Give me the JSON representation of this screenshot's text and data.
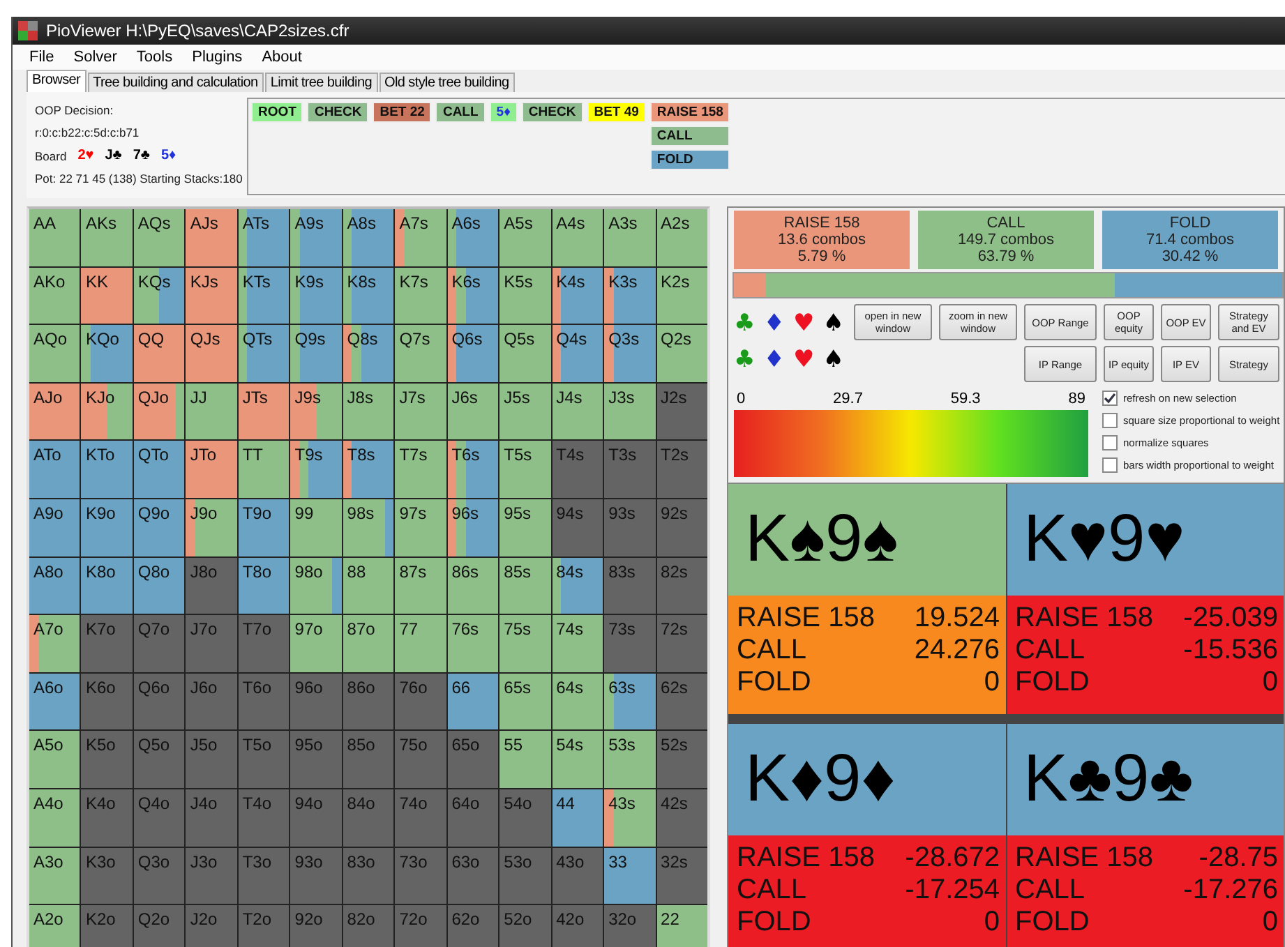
{
  "window": {
    "title": "PioViewer H:\\PyEQ\\saves\\CAP2sizes.cfr"
  },
  "menu": [
    "File",
    "Solver",
    "Tools",
    "Plugins",
    "About"
  ],
  "tabs": [
    {
      "label": "Browser",
      "selected": true
    },
    {
      "label": "Tree building and calculation",
      "selected": false
    },
    {
      "label": "Limit tree building",
      "selected": false
    },
    {
      "label": "Old style tree building",
      "selected": false
    }
  ],
  "info": {
    "decision": "OOP Decision:",
    "line": "r:0:c:b22:c:5d:c:b71",
    "board_label": "Board",
    "board": [
      {
        "text": "2♥",
        "color": "#ff0000"
      },
      {
        "text": "J♣",
        "color": "#000000"
      },
      {
        "text": "7♣",
        "color": "#000000"
      },
      {
        "text": "5♦",
        "color": "#2233dd"
      }
    ],
    "pot": "Pot: 22 71 45 (138) Starting Stacks:180"
  },
  "tree": {
    "path": [
      {
        "label": "ROOT",
        "kind": "action",
        "color": "#90ee90"
      },
      {
        "label": "CHECK",
        "kind": "action",
        "color": "#8fbc8f"
      },
      {
        "label": "BET 22",
        "kind": "action",
        "color": "#c8745c"
      },
      {
        "label": "CALL",
        "kind": "action",
        "color": "#8fbc8f"
      },
      {
        "label": "5♦",
        "kind": "card",
        "color": "#90ee90"
      },
      {
        "label": "CHECK",
        "kind": "action",
        "color": "#8fbc8f"
      },
      {
        "label": "BET 49",
        "kind": "action",
        "color": "#ffff00"
      },
      {
        "label": "RAISE 158",
        "kind": "action",
        "color": "#e9967a"
      }
    ],
    "options": [
      {
        "label": "CALL",
        "kind": "action",
        "color": "#8fbc8f"
      },
      {
        "label": "FOLD",
        "kind": "action",
        "color": "#6aa3c3"
      }
    ]
  },
  "grid": {
    "rows": [
      {
        "cells": [
          {
            "hand": "AA",
            "in_range": true,
            "segments": [
              {
                "kind": "call",
                "dominant": true
              }
            ]
          },
          {
            "hand": "AKs",
            "in_range": true,
            "segments": [
              {
                "kind": "call",
                "dominant": true
              }
            ]
          },
          {
            "hand": "AQs",
            "in_range": true,
            "segments": [
              {
                "kind": "call",
                "dominant": true
              }
            ]
          },
          {
            "hand": "AJs",
            "in_range": true,
            "segments": [
              {
                "kind": "raise",
                "dominant": true
              }
            ]
          },
          {
            "hand": "ATs",
            "in_range": true,
            "segments": [
              {
                "kind": "call",
                "dominant": false
              },
              {
                "kind": "fold",
                "dominant": true
              }
            ]
          },
          {
            "hand": "A9s",
            "in_range": true,
            "segments": [
              {
                "kind": "call",
                "dominant": false
              },
              {
                "kind": "fold",
                "dominant": true
              }
            ]
          },
          {
            "hand": "A8s",
            "in_range": true,
            "segments": [
              {
                "kind": "call",
                "dominant": false
              },
              {
                "kind": "fold",
                "dominant": true
              }
            ]
          },
          {
            "hand": "A7s",
            "in_range": true,
            "segments": [
              {
                "kind": "raise",
                "dominant": false
              },
              {
                "kind": "call",
                "dominant": true
              }
            ]
          },
          {
            "hand": "A6s",
            "in_range": true,
            "segments": [
              {
                "kind": "call",
                "dominant": false
              },
              {
                "kind": "fold",
                "dominant": true
              }
            ]
          },
          {
            "hand": "A5s",
            "in_range": true,
            "segments": [
              {
                "kind": "call",
                "dominant": true
              }
            ]
          },
          {
            "hand": "A4s",
            "in_range": true,
            "segments": [
              {
                "kind": "call",
                "dominant": true
              }
            ]
          },
          {
            "hand": "A3s",
            "in_range": true,
            "segments": [
              {
                "kind": "call",
                "dominant": true
              }
            ]
          },
          {
            "hand": "A2s",
            "in_range": true,
            "segments": [
              {
                "kind": "call",
                "dominant": true
              }
            ]
          }
        ]
      },
      {
        "cells": [
          {
            "hand": "AKo",
            "in_range": true,
            "segments": [
              {
                "kind": "call",
                "dominant": true
              }
            ]
          },
          {
            "hand": "KK",
            "in_range": true,
            "segments": [
              {
                "kind": "raise",
                "dominant": true
              }
            ]
          },
          {
            "hand": "KQs",
            "in_range": true,
            "segments": [
              {
                "kind": "call",
                "dominant": true
              },
              {
                "kind": "fold",
                "dominant": true
              }
            ]
          },
          {
            "hand": "KJs",
            "in_range": true,
            "segments": [
              {
                "kind": "raise",
                "dominant": true
              }
            ]
          },
          {
            "hand": "KTs",
            "in_range": true,
            "segments": [
              {
                "kind": "call",
                "dominant": false
              },
              {
                "kind": "fold",
                "dominant": true
              }
            ]
          },
          {
            "hand": "K9s",
            "in_range": true,
            "segments": [
              {
                "kind": "call",
                "dominant": false
              },
              {
                "kind": "fold",
                "dominant": true
              }
            ]
          },
          {
            "hand": "K8s",
            "in_range": true,
            "segments": [
              {
                "kind": "call",
                "dominant": false
              },
              {
                "kind": "fold",
                "dominant": true
              }
            ]
          },
          {
            "hand": "K7s",
            "in_range": true,
            "segments": [
              {
                "kind": "call",
                "dominant": true
              }
            ]
          },
          {
            "hand": "K6s",
            "in_range": true,
            "segments": [
              {
                "kind": "raise",
                "dominant": false
              },
              {
                "kind": "call",
                "dominant": false
              },
              {
                "kind": "fold",
                "dominant": true
              }
            ]
          },
          {
            "hand": "K5s",
            "in_range": true,
            "segments": [
              {
                "kind": "call",
                "dominant": true
              }
            ]
          },
          {
            "hand": "K4s",
            "in_range": true,
            "segments": [
              {
                "kind": "raise",
                "dominant": false
              },
              {
                "kind": "fold",
                "dominant": true
              }
            ]
          },
          {
            "hand": "K3s",
            "in_range": true,
            "segments": [
              {
                "kind": "raise",
                "dominant": false
              },
              {
                "kind": "fold",
                "dominant": true
              }
            ]
          },
          {
            "hand": "K2s",
            "in_range": true,
            "segments": [
              {
                "kind": "call",
                "dominant": true
              }
            ]
          }
        ]
      },
      {
        "cells": [
          {
            "hand": "AQo",
            "in_range": true,
            "segments": [
              {
                "kind": "call",
                "dominant": true
              }
            ]
          },
          {
            "hand": "KQo",
            "in_range": true,
            "segments": [
              {
                "kind": "call",
                "dominant": false
              },
              {
                "kind": "fold",
                "dominant": true
              }
            ]
          },
          {
            "hand": "QQ",
            "in_range": true,
            "segments": [
              {
                "kind": "raise",
                "dominant": true
              }
            ]
          },
          {
            "hand": "QJs",
            "in_range": true,
            "segments": [
              {
                "kind": "raise",
                "dominant": true
              }
            ]
          },
          {
            "hand": "QTs",
            "in_range": true,
            "segments": [
              {
                "kind": "call",
                "dominant": false
              },
              {
                "kind": "fold",
                "dominant": true
              }
            ]
          },
          {
            "hand": "Q9s",
            "in_range": true,
            "segments": [
              {
                "kind": "call",
                "dominant": false
              },
              {
                "kind": "fold",
                "dominant": true
              }
            ]
          },
          {
            "hand": "Q8s",
            "in_range": true,
            "segments": [
              {
                "kind": "raise",
                "dominant": false
              },
              {
                "kind": "call",
                "dominant": false
              },
              {
                "kind": "fold",
                "dominant": true
              }
            ]
          },
          {
            "hand": "Q7s",
            "in_range": true,
            "segments": [
              {
                "kind": "call",
                "dominant": true
              }
            ]
          },
          {
            "hand": "Q6s",
            "in_range": true,
            "segments": [
              {
                "kind": "raise",
                "dominant": false
              },
              {
                "kind": "fold",
                "dominant": true
              }
            ]
          },
          {
            "hand": "Q5s",
            "in_range": true,
            "segments": [
              {
                "kind": "call",
                "dominant": true
              }
            ]
          },
          {
            "hand": "Q4s",
            "in_range": true,
            "segments": [
              {
                "kind": "raise",
                "dominant": false
              },
              {
                "kind": "fold",
                "dominant": true
              }
            ]
          },
          {
            "hand": "Q3s",
            "in_range": true,
            "segments": [
              {
                "kind": "raise",
                "dominant": false
              },
              {
                "kind": "fold",
                "dominant": true
              }
            ]
          },
          {
            "hand": "Q2s",
            "in_range": true,
            "segments": [
              {
                "kind": "call",
                "dominant": true
              }
            ]
          }
        ]
      },
      {
        "cells": [
          {
            "hand": "AJo",
            "in_range": true,
            "segments": [
              {
                "kind": "raise",
                "dominant": true
              }
            ]
          },
          {
            "hand": "KJo",
            "in_range": true,
            "segments": [
              {
                "kind": "raise",
                "dominant": true
              },
              {
                "kind": "call",
                "dominant": true
              }
            ]
          },
          {
            "hand": "QJo",
            "in_range": true,
            "segments": [
              {
                "kind": "raise",
                "dominant": true
              },
              {
                "kind": "call",
                "dominant": false
              }
            ]
          },
          {
            "hand": "JJ",
            "in_range": true,
            "segments": [
              {
                "kind": "call",
                "dominant": true
              }
            ]
          },
          {
            "hand": "JTs",
            "in_range": true,
            "segments": [
              {
                "kind": "raise",
                "dominant": true
              }
            ]
          },
          {
            "hand": "J9s",
            "in_range": true,
            "segments": [
              {
                "kind": "raise",
                "dominant": true
              },
              {
                "kind": "call",
                "dominant": true
              }
            ]
          },
          {
            "hand": "J8s",
            "in_range": true,
            "segments": [
              {
                "kind": "call",
                "dominant": true
              }
            ]
          },
          {
            "hand": "J7s",
            "in_range": true,
            "segments": [
              {
                "kind": "call",
                "dominant": true
              }
            ]
          },
          {
            "hand": "J6s",
            "in_range": true,
            "segments": [
              {
                "kind": "call",
                "dominant": true
              }
            ]
          },
          {
            "hand": "J5s",
            "in_range": true,
            "segments": [
              {
                "kind": "call",
                "dominant": true
              }
            ]
          },
          {
            "hand": "J4s",
            "in_range": true,
            "segments": [
              {
                "kind": "call",
                "dominant": true
              }
            ]
          },
          {
            "hand": "J3s",
            "in_range": true,
            "segments": [
              {
                "kind": "call",
                "dominant": true
              }
            ]
          },
          {
            "hand": "J2s",
            "in_range": false
          }
        ]
      },
      {
        "cells": [
          {
            "hand": "ATo",
            "in_range": true,
            "segments": [
              {
                "kind": "fold",
                "dominant": true
              }
            ]
          },
          {
            "hand": "KTo",
            "in_range": true,
            "segments": [
              {
                "kind": "fold",
                "dominant": true
              }
            ]
          },
          {
            "hand": "QTo",
            "in_range": true,
            "segments": [
              {
                "kind": "fold",
                "dominant": true
              }
            ]
          },
          {
            "hand": "JTo",
            "in_range": true,
            "segments": [
              {
                "kind": "raise",
                "dominant": true
              }
            ]
          },
          {
            "hand": "TT",
            "in_range": true,
            "segments": [
              {
                "kind": "call",
                "dominant": true
              }
            ]
          },
          {
            "hand": "T9s",
            "in_range": true,
            "segments": [
              {
                "kind": "raise",
                "dominant": false
              },
              {
                "kind": "call",
                "dominant": false
              },
              {
                "kind": "fold",
                "dominant": true
              }
            ]
          },
          {
            "hand": "T8s",
            "in_range": true,
            "segments": [
              {
                "kind": "raise",
                "dominant": false
              },
              {
                "kind": "fold",
                "dominant": true
              }
            ]
          },
          {
            "hand": "T7s",
            "in_range": true,
            "segments": [
              {
                "kind": "call",
                "dominant": true
              }
            ]
          },
          {
            "hand": "T6s",
            "in_range": true,
            "segments": [
              {
                "kind": "raise",
                "dominant": false
              },
              {
                "kind": "call",
                "dominant": false
              },
              {
                "kind": "fold",
                "dominant": true
              }
            ]
          },
          {
            "hand": "T5s",
            "in_range": true,
            "segments": [
              {
                "kind": "call",
                "dominant": true
              }
            ]
          },
          {
            "hand": "T4s",
            "in_range": false
          },
          {
            "hand": "T3s",
            "in_range": false
          },
          {
            "hand": "T2s",
            "in_range": false
          }
        ]
      },
      {
        "cells": [
          {
            "hand": "A9o",
            "in_range": true,
            "segments": [
              {
                "kind": "fold",
                "dominant": true
              }
            ]
          },
          {
            "hand": "K9o",
            "in_range": true,
            "segments": [
              {
                "kind": "fold",
                "dominant": true
              }
            ]
          },
          {
            "hand": "Q9o",
            "in_range": true,
            "segments": [
              {
                "kind": "fold",
                "dominant": true
              }
            ]
          },
          {
            "hand": "J9o",
            "in_range": true,
            "segments": [
              {
                "kind": "raise",
                "dominant": false
              },
              {
                "kind": "call",
                "dominant": true
              }
            ]
          },
          {
            "hand": "T9o",
            "in_range": true,
            "segments": [
              {
                "kind": "fold",
                "dominant": true
              }
            ]
          },
          {
            "hand": "99",
            "in_range": true,
            "segments": [
              {
                "kind": "call",
                "dominant": true
              }
            ]
          },
          {
            "hand": "98s",
            "in_range": true,
            "segments": [
              {
                "kind": "call",
                "dominant": true
              },
              {
                "kind": "fold",
                "dominant": false
              }
            ]
          },
          {
            "hand": "97s",
            "in_range": true,
            "segments": [
              {
                "kind": "call",
                "dominant": true
              }
            ]
          },
          {
            "hand": "96s",
            "in_range": true,
            "segments": [
              {
                "kind": "raise",
                "dominant": false
              },
              {
                "kind": "call",
                "dominant": false
              },
              {
                "kind": "fold",
                "dominant": true
              }
            ]
          },
          {
            "hand": "95s",
            "in_range": true,
            "segments": [
              {
                "kind": "call",
                "dominant": true
              }
            ]
          },
          {
            "hand": "94s",
            "in_range": false
          },
          {
            "hand": "93s",
            "in_range": false
          },
          {
            "hand": "92s",
            "in_range": false
          }
        ]
      },
      {
        "cells": [
          {
            "hand": "A8o",
            "in_range": true,
            "segments": [
              {
                "kind": "fold",
                "dominant": true
              }
            ]
          },
          {
            "hand": "K8o",
            "in_range": true,
            "segments": [
              {
                "kind": "fold",
                "dominant": true
              }
            ]
          },
          {
            "hand": "Q8o",
            "in_range": true,
            "segments": [
              {
                "kind": "fold",
                "dominant": true
              }
            ]
          },
          {
            "hand": "J8o",
            "in_range": false
          },
          {
            "hand": "T8o",
            "in_range": true,
            "segments": [
              {
                "kind": "fold",
                "dominant": true
              }
            ]
          },
          {
            "hand": "98o",
            "in_range": true,
            "segments": [
              {
                "kind": "call",
                "dominant": true
              },
              {
                "kind": "fold",
                "dominant": false
              }
            ]
          },
          {
            "hand": "88",
            "in_range": true,
            "segments": [
              {
                "kind": "call",
                "dominant": true
              }
            ]
          },
          {
            "hand": "87s",
            "in_range": true,
            "segments": [
              {
                "kind": "call",
                "dominant": true
              }
            ]
          },
          {
            "hand": "86s",
            "in_range": true,
            "segments": [
              {
                "kind": "call",
                "dominant": true
              }
            ]
          },
          {
            "hand": "85s",
            "in_range": true,
            "segments": [
              {
                "kind": "call",
                "dominant": true
              }
            ]
          },
          {
            "hand": "84s",
            "in_range": true,
            "segments": [
              {
                "kind": "call",
                "dominant": false
              },
              {
                "kind": "fold",
                "dominant": true
              }
            ]
          },
          {
            "hand": "83s",
            "in_range": false
          },
          {
            "hand": "82s",
            "in_range": false
          }
        ]
      },
      {
        "cells": [
          {
            "hand": "A7o",
            "in_range": true,
            "segments": [
              {
                "kind": "raise",
                "dominant": false
              },
              {
                "kind": "call",
                "dominant": true
              }
            ]
          },
          {
            "hand": "K7o",
            "in_range": false
          },
          {
            "hand": "Q7o",
            "in_range": false
          },
          {
            "hand": "J7o",
            "in_range": false
          },
          {
            "hand": "T7o",
            "in_range": false
          },
          {
            "hand": "97o",
            "in_range": true,
            "segments": [
              {
                "kind": "call",
                "dominant": true
              }
            ]
          },
          {
            "hand": "87o",
            "in_range": true,
            "segments": [
              {
                "kind": "call",
                "dominant": true
              }
            ]
          },
          {
            "hand": "77",
            "in_range": true,
            "segments": [
              {
                "kind": "call",
                "dominant": true
              }
            ]
          },
          {
            "hand": "76s",
            "in_range": true,
            "segments": [
              {
                "kind": "call",
                "dominant": true
              }
            ]
          },
          {
            "hand": "75s",
            "in_range": true,
            "segments": [
              {
                "kind": "call",
                "dominant": true
              }
            ]
          },
          {
            "hand": "74s",
            "in_range": true,
            "segments": [
              {
                "kind": "call",
                "dominant": true
              }
            ]
          },
          {
            "hand": "73s",
            "in_range": false
          },
          {
            "hand": "72s",
            "in_range": false
          }
        ]
      },
      {
        "cells": [
          {
            "hand": "A6o",
            "in_range": true,
            "segments": [
              {
                "kind": "fold",
                "dominant": true
              }
            ]
          },
          {
            "hand": "K6o",
            "in_range": false
          },
          {
            "hand": "Q6o",
            "in_range": false
          },
          {
            "hand": "J6o",
            "in_range": false
          },
          {
            "hand": "T6o",
            "in_range": false
          },
          {
            "hand": "96o",
            "in_range": false
          },
          {
            "hand": "86o",
            "in_range": false
          },
          {
            "hand": "76o",
            "in_range": false
          },
          {
            "hand": "66",
            "in_range": true,
            "segments": [
              {
                "kind": "fold",
                "dominant": true
              }
            ]
          },
          {
            "hand": "65s",
            "in_range": true,
            "segments": [
              {
                "kind": "call",
                "dominant": true
              }
            ]
          },
          {
            "hand": "64s",
            "in_range": true,
            "segments": [
              {
                "kind": "call",
                "dominant": true
              }
            ]
          },
          {
            "hand": "63s",
            "in_range": true,
            "segments": [
              {
                "kind": "call",
                "dominant": false
              },
              {
                "kind": "fold",
                "dominant": true
              }
            ]
          },
          {
            "hand": "62s",
            "in_range": false
          }
        ]
      },
      {
        "cells": [
          {
            "hand": "A5o",
            "in_range": true,
            "segments": [
              {
                "kind": "call",
                "dominant": true
              }
            ]
          },
          {
            "hand": "K5o",
            "in_range": false
          },
          {
            "hand": "Q5o",
            "in_range": false
          },
          {
            "hand": "J5o",
            "in_range": false
          },
          {
            "hand": "T5o",
            "in_range": false
          },
          {
            "hand": "95o",
            "in_range": false
          },
          {
            "hand": "85o",
            "in_range": false
          },
          {
            "hand": "75o",
            "in_range": false
          },
          {
            "hand": "65o",
            "in_range": false
          },
          {
            "hand": "55",
            "in_range": true,
            "segments": [
              {
                "kind": "call",
                "dominant": true
              }
            ]
          },
          {
            "hand": "54s",
            "in_range": true,
            "segments": [
              {
                "kind": "call",
                "dominant": true
              }
            ]
          },
          {
            "hand": "53s",
            "in_range": true,
            "segments": [
              {
                "kind": "call",
                "dominant": true
              }
            ]
          },
          {
            "hand": "52s",
            "in_range": false
          }
        ]
      },
      {
        "cells": [
          {
            "hand": "A4o",
            "in_range": true,
            "segments": [
              {
                "kind": "call",
                "dominant": true
              }
            ]
          },
          {
            "hand": "K4o",
            "in_range": false
          },
          {
            "hand": "Q4o",
            "in_range": false
          },
          {
            "hand": "J4o",
            "in_range": false
          },
          {
            "hand": "T4o",
            "in_range": false
          },
          {
            "hand": "94o",
            "in_range": false
          },
          {
            "hand": "84o",
            "in_range": false
          },
          {
            "hand": "74o",
            "in_range": false
          },
          {
            "hand": "64o",
            "in_range": false
          },
          {
            "hand": "54o",
            "in_range": false
          },
          {
            "hand": "44",
            "in_range": true,
            "segments": [
              {
                "kind": "fold",
                "dominant": true
              }
            ]
          },
          {
            "hand": "43s",
            "in_range": true,
            "segments": [
              {
                "kind": "raise",
                "dominant": false
              },
              {
                "kind": "call",
                "dominant": true
              }
            ]
          },
          {
            "hand": "42s",
            "in_range": false
          }
        ]
      },
      {
        "cells": [
          {
            "hand": "A3o",
            "in_range": true,
            "segments": [
              {
                "kind": "call",
                "dominant": true
              }
            ]
          },
          {
            "hand": "K3o",
            "in_range": false
          },
          {
            "hand": "Q3o",
            "in_range": false
          },
          {
            "hand": "J3o",
            "in_range": false
          },
          {
            "hand": "T3o",
            "in_range": false
          },
          {
            "hand": "93o",
            "in_range": false
          },
          {
            "hand": "83o",
            "in_range": false
          },
          {
            "hand": "73o",
            "in_range": false
          },
          {
            "hand": "63o",
            "in_range": false
          },
          {
            "hand": "53o",
            "in_range": false
          },
          {
            "hand": "43o",
            "in_range": false
          },
          {
            "hand": "33",
            "in_range": true,
            "segments": [
              {
                "kind": "fold",
                "dominant": true
              }
            ]
          },
          {
            "hand": "32s",
            "in_range": false
          }
        ]
      },
      {
        "cells": [
          {
            "hand": "A2o",
            "in_range": true,
            "segments": [
              {
                "kind": "call",
                "dominant": true
              }
            ]
          },
          {
            "hand": "K2o",
            "in_range": false
          },
          {
            "hand": "Q2o",
            "in_range": false
          },
          {
            "hand": "J2o",
            "in_range": false
          },
          {
            "hand": "T2o",
            "in_range": false
          },
          {
            "hand": "92o",
            "in_range": false
          },
          {
            "hand": "82o",
            "in_range": false
          },
          {
            "hand": "72o",
            "in_range": false
          },
          {
            "hand": "62o",
            "in_range": false
          },
          {
            "hand": "52o",
            "in_range": false
          },
          {
            "hand": "42o",
            "in_range": false
          },
          {
            "hand": "32o",
            "in_range": false
          },
          {
            "hand": "22",
            "in_range": true,
            "segments": [
              {
                "kind": "call",
                "dominant": true
              }
            ]
          }
        ]
      }
    ]
  },
  "summary": [
    {
      "kind": "raise",
      "action": "RAISE 158",
      "combos": "13.6 combos",
      "percent": "5.79 %"
    },
    {
      "kind": "call",
      "action": "CALL",
      "combos": "149.7 combos",
      "percent": "63.79 %"
    },
    {
      "kind": "fold",
      "action": "FOLD",
      "combos": "71.4 combos",
      "percent": "30.42 %"
    }
  ],
  "suit_rows": [
    [
      {
        "symbol": "♣",
        "color": "#1a9c1a"
      },
      {
        "symbol": "♦",
        "color": "#2233cc"
      },
      {
        "symbol": "♥",
        "color": "#ee1122"
      },
      {
        "symbol": "♠",
        "color": "#000000"
      }
    ],
    [
      {
        "symbol": "♣",
        "color": "#1a9c1a"
      },
      {
        "symbol": "♦",
        "color": "#2233cc"
      },
      {
        "symbol": "♥",
        "color": "#ee1122"
      },
      {
        "symbol": "♠",
        "color": "#000000"
      }
    ]
  ],
  "button_rows": [
    [
      "open in new window",
      "zoom in new window",
      "OOP Range",
      "OOP equity",
      "OOP EV",
      "Strategy and EV"
    ],
    [
      "IP  Range",
      "IP equity",
      "IP  EV",
      "Strategy"
    ]
  ],
  "scale_labels": [
    "0",
    "29.7",
    "59.3",
    "89"
  ],
  "options": [
    {
      "label": "refresh on new selection",
      "checked": true
    },
    {
      "label": "square size proportional to weight",
      "checked": false
    },
    {
      "label": "normalize squares",
      "checked": false
    },
    {
      "label": "bars width proportional to weight",
      "checked": false
    }
  ],
  "hands": [
    {
      "title": "K♠9♠",
      "kind": "call",
      "color": "#f7891f",
      "evs": [
        {
          "action": "RAISE 158",
          "value": "19.524"
        },
        {
          "action": "CALL",
          "value": "24.276"
        },
        {
          "action": "FOLD",
          "value": "0"
        }
      ]
    },
    {
      "title": "K♥9♥",
      "kind": "fold",
      "color": "#ec1c24",
      "evs": [
        {
          "action": "RAISE 158",
          "value": "-25.039"
        },
        {
          "action": "CALL",
          "value": "-15.536"
        },
        {
          "action": "FOLD",
          "value": "0"
        }
      ]
    },
    {
      "title": "K♦9♦",
      "kind": "fold",
      "color": "#ec1c24",
      "evs": [
        {
          "action": "RAISE 158",
          "value": "-28.672"
        },
        {
          "action": "CALL",
          "value": "-17.254"
        },
        {
          "action": "FOLD",
          "value": "0"
        }
      ]
    },
    {
      "title": "K♣9♣",
      "kind": "fold",
      "color": "#ec1c24",
      "evs": [
        {
          "action": "RAISE 158",
          "value": "-28.75"
        },
        {
          "action": "CALL",
          "value": "-17.276"
        },
        {
          "action": "FOLD",
          "value": "0"
        }
      ]
    }
  ]
}
